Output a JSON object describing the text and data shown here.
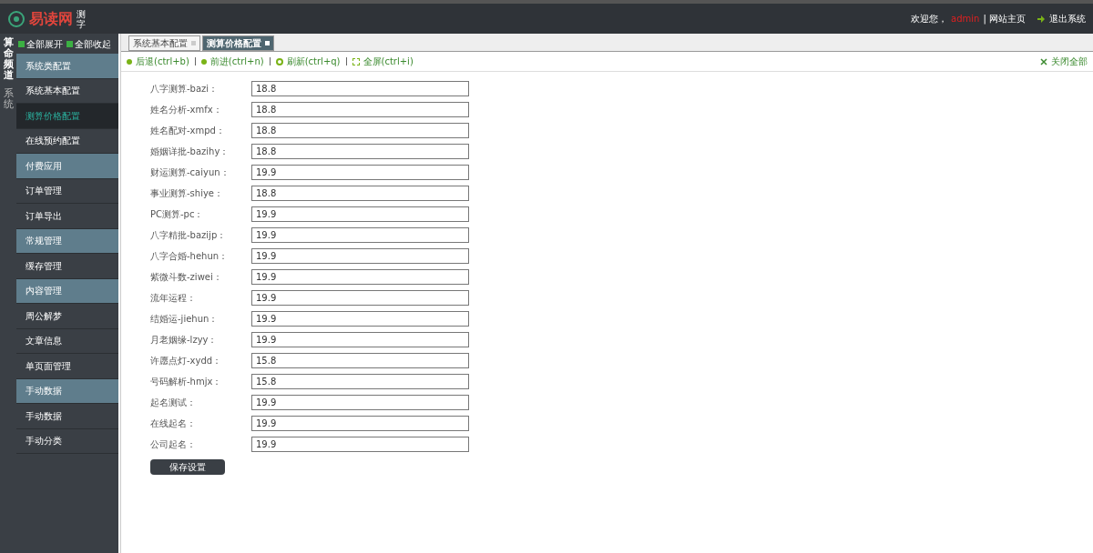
{
  "header": {
    "logo": "易读网",
    "logo_tag": "测字",
    "welcome": "欢迎您，",
    "user": "admin",
    "links": [
      "| 网站主页",
      "退出系统"
    ]
  },
  "sidebar": {
    "vertical_titles": [
      {
        "text": "算命频道",
        "selected": true
      },
      {
        "text": "系统",
        "selected": false
      }
    ],
    "actions": [
      "全部展开",
      "全部收起"
    ],
    "items": [
      {
        "kind": "group",
        "label": "系统类配置",
        "selected": false
      },
      {
        "kind": "item",
        "label": "系统基本配置",
        "selected": false
      },
      {
        "kind": "item",
        "label": "测算价格配置",
        "selected": true
      },
      {
        "kind": "item",
        "label": "在线预约配置",
        "selected": false
      },
      {
        "kind": "group",
        "label": "付费应用",
        "selected": false
      },
      {
        "kind": "item",
        "label": "订单管理",
        "selected": false
      },
      {
        "kind": "item",
        "label": "订单导出",
        "selected": false
      },
      {
        "kind": "group",
        "label": "常规管理",
        "selected": false
      },
      {
        "kind": "item",
        "label": "缓存管理",
        "selected": false
      },
      {
        "kind": "group",
        "label": "内容管理",
        "selected": false
      },
      {
        "kind": "item",
        "label": "周公解梦",
        "selected": false
      },
      {
        "kind": "item",
        "label": "文章信息",
        "selected": false
      },
      {
        "kind": "item",
        "label": "单页面管理",
        "selected": false
      },
      {
        "kind": "group",
        "label": "手动数据",
        "selected": false
      },
      {
        "kind": "item",
        "label": "手动数据",
        "selected": false
      },
      {
        "kind": "item",
        "label": "手动分类",
        "selected": false
      }
    ]
  },
  "tabs": [
    {
      "label": "系统基本配置",
      "selected": false
    },
    {
      "label": "测算价格配置",
      "selected": true
    }
  ],
  "toolbar": {
    "actions": [
      {
        "kind": "back",
        "label": "后退(ctrl+b)"
      },
      {
        "kind": "forward",
        "label": "前进(ctrl+n)"
      },
      {
        "kind": "refresh",
        "label": "刷新(ctrl+q)"
      },
      {
        "kind": "fullscreen",
        "label": "全屏(ctrl+i)"
      }
    ],
    "close_all": "关闭全部"
  },
  "form": {
    "fields": [
      {
        "label": "八字测算-bazi：",
        "value": "18.8"
      },
      {
        "label": "姓名分析-xmfx：",
        "value": "18.8"
      },
      {
        "label": "姓名配对-xmpd：",
        "value": "18.8"
      },
      {
        "label": "婚姻详批-bazihy：",
        "value": "18.8"
      },
      {
        "label": "财运测算-caiyun：",
        "value": "19.9"
      },
      {
        "label": "事业测算-shiye：",
        "value": "18.8"
      },
      {
        "label": "PC测算-pc：",
        "value": "19.9"
      },
      {
        "label": "八字精批-bazijp：",
        "value": "19.9"
      },
      {
        "label": "八字合婚-hehun：",
        "value": "19.9"
      },
      {
        "label": "紫微斗数-ziwei：",
        "value": "19.9"
      },
      {
        "label": "流年运程：",
        "value": "19.9"
      },
      {
        "label": "结婚运-jiehun：",
        "value": "19.9"
      },
      {
        "label": "月老姻缘-lzyy：",
        "value": "19.9"
      },
      {
        "label": "许愿点灯-xydd：",
        "value": "15.8"
      },
      {
        "label": "号码解析-hmjx：",
        "value": "15.8"
      },
      {
        "label": "起名测试：",
        "value": "19.9"
      },
      {
        "label": "在线起名：",
        "value": "19.9"
      },
      {
        "label": "公司起名：",
        "value": "19.9"
      }
    ],
    "submit": "保存设置"
  }
}
